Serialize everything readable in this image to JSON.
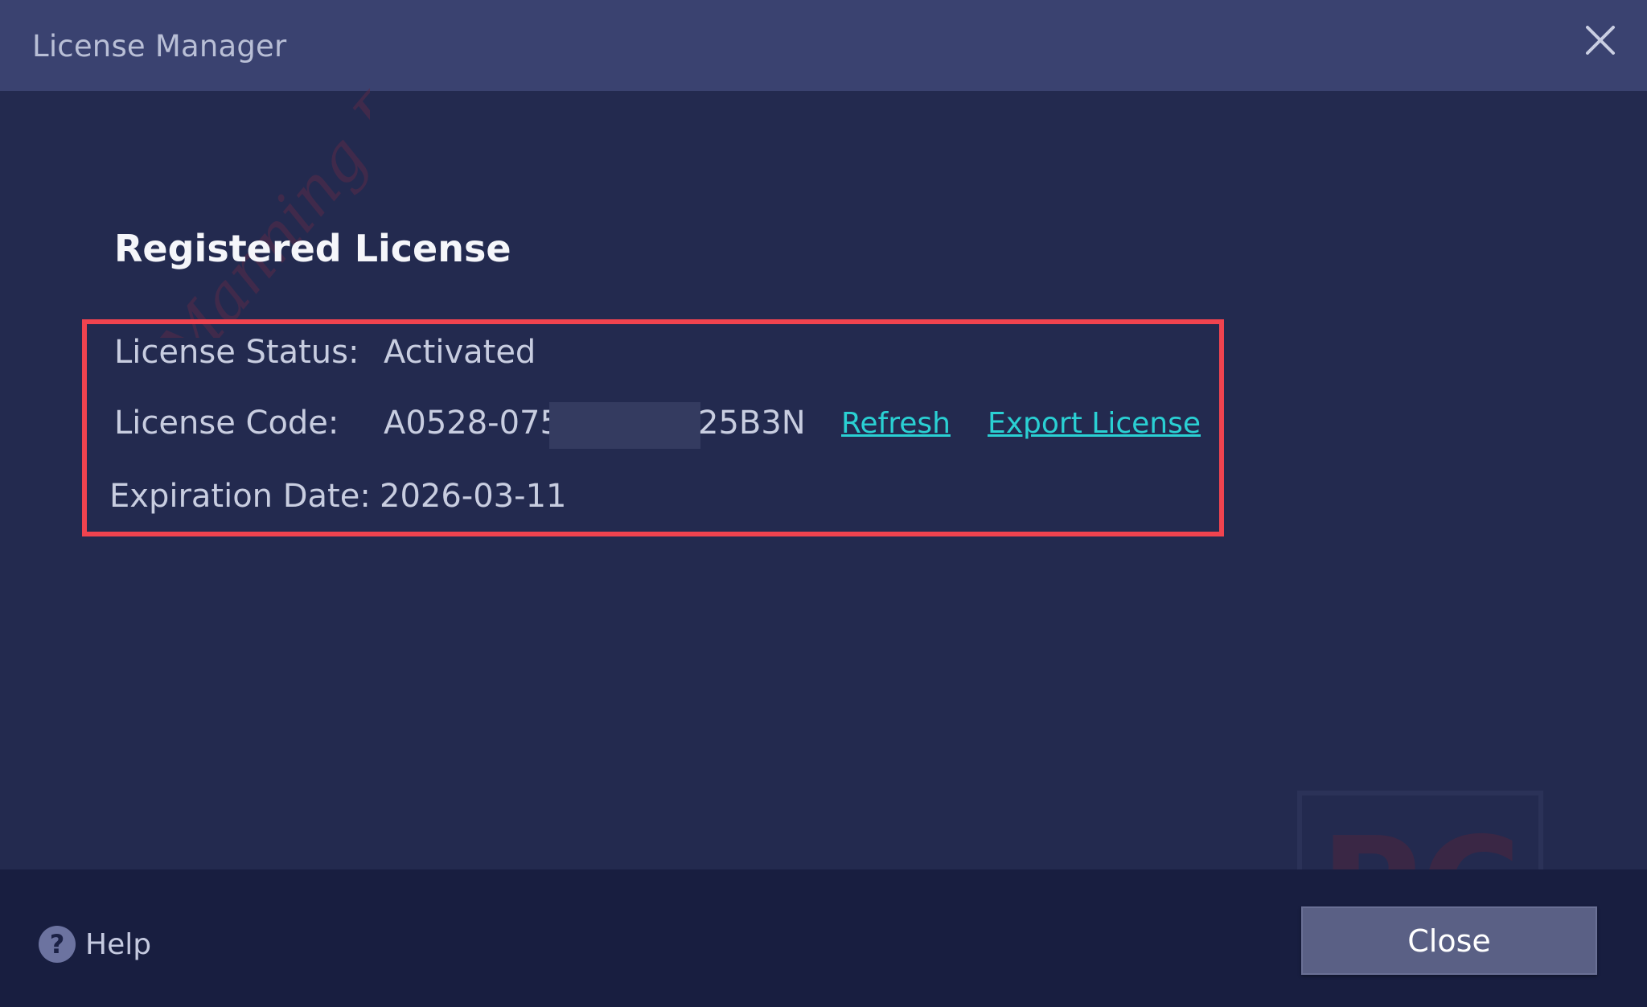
{
  "window": {
    "title": "License Manager",
    "close_icon": "close-icon"
  },
  "main": {
    "section_title": "Registered License",
    "fields": {
      "status_label": "License Status:",
      "status_value": "Activated",
      "code_label": "License Code:",
      "code_value_start": "A0528-075",
      "code_value_end": "25B3N",
      "code_masked": true,
      "expiration_label": "Expiration Date:",
      "expiration_value": "2026-03-11"
    },
    "links": {
      "refresh": "Refresh",
      "export": "Export License"
    },
    "highlight_color": "#f0434f",
    "link_color": "#2ad0d3"
  },
  "watermark": {
    "diagonal_text": "Manning PC",
    "badge_text": "PC"
  },
  "footer": {
    "help_icon": "help-icon",
    "help_glyph": "?",
    "help_label": "Help",
    "close_button": "Close"
  },
  "colors": {
    "titlebar": "#3a4270",
    "body": "#232a4f",
    "footer": "#181e40"
  }
}
